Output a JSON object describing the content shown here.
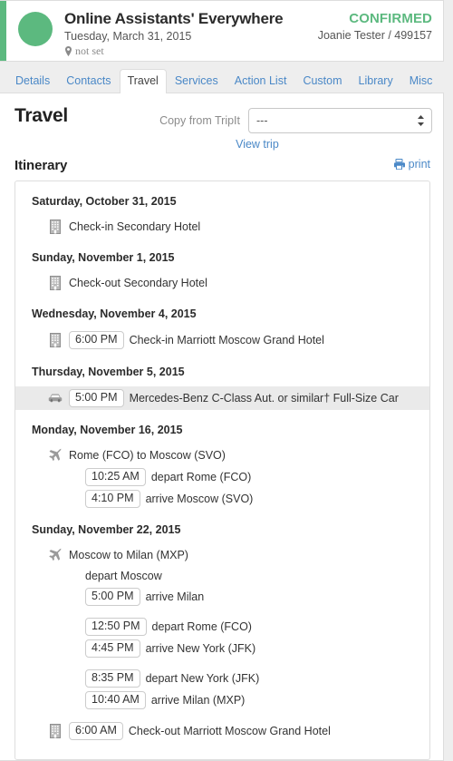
{
  "header": {
    "title": "Online Assistants' Everywhere",
    "date": "Tuesday, March 31, 2015",
    "location": "not set",
    "location_icon": "map-pin-icon",
    "status": "CONFIRMED",
    "owner": "Joanie Tester / 499157",
    "accent_color": "#5cb97f",
    "status_color": "#5cb97f"
  },
  "tabs": [
    {
      "label": "Details",
      "active": false
    },
    {
      "label": "Contacts",
      "active": false
    },
    {
      "label": "Travel",
      "active": true
    },
    {
      "label": "Services",
      "active": false
    },
    {
      "label": "Action List",
      "active": false
    },
    {
      "label": "Custom",
      "active": false
    },
    {
      "label": "Library",
      "active": false
    },
    {
      "label": "Misc",
      "active": false
    }
  ],
  "travel": {
    "title": "Travel",
    "copy_label": "Copy from TripIt",
    "select_value": "---",
    "view_trip_label": "View trip",
    "itinerary_label": "Itinerary",
    "print_label": "print",
    "print_icon": "printer-icon",
    "link_color": "#4a88c7"
  },
  "itinerary": [
    {
      "date": "Saturday, October 31, 2015",
      "rows": [
        {
          "icon": "hotel-icon",
          "time": "",
          "text": "Check-in Secondary Hotel",
          "highlight": false,
          "indent": false
        }
      ]
    },
    {
      "date": "Sunday, November 1, 2015",
      "rows": [
        {
          "icon": "hotel-icon",
          "time": "",
          "text": "Check-out Secondary Hotel",
          "highlight": false,
          "indent": false
        }
      ]
    },
    {
      "date": "Wednesday, November 4, 2015",
      "rows": [
        {
          "icon": "hotel-icon",
          "time": "6:00 PM",
          "text": "Check-in Marriott Moscow Grand Hotel",
          "highlight": false,
          "indent": false
        }
      ]
    },
    {
      "date": "Thursday, November 5, 2015",
      "rows": [
        {
          "icon": "car-icon",
          "time": "5:00 PM",
          "text": "Mercedes-Benz C-Class Aut. or similar† Full-Size Car",
          "highlight": true,
          "indent": false
        }
      ]
    },
    {
      "date": "Monday, November 16, 2015",
      "rows": [
        {
          "icon": "plane-icon",
          "time": "",
          "text": "Rome (FCO) to Moscow (SVO)",
          "highlight": false,
          "indent": false
        },
        {
          "icon": "",
          "time": "10:25 AM",
          "text": "depart Rome (FCO)",
          "highlight": false,
          "indent": true
        },
        {
          "icon": "",
          "time": "4:10 PM",
          "text": "arrive Moscow (SVO)",
          "highlight": false,
          "indent": true
        }
      ]
    },
    {
      "date": "Sunday, November 22, 2015",
      "rows": [
        {
          "icon": "plane-icon",
          "time": "",
          "text": "Moscow to Milan (MXP)",
          "highlight": false,
          "indent": false
        },
        {
          "icon": "",
          "time": "",
          "text": "depart Moscow",
          "highlight": false,
          "indent": true
        },
        {
          "icon": "",
          "time": "5:00 PM",
          "text": "arrive Milan",
          "highlight": false,
          "indent": true
        },
        {
          "icon": "",
          "time": "",
          "text": "",
          "highlight": false,
          "indent": true,
          "spacer": true
        },
        {
          "icon": "",
          "time": "12:50 PM",
          "text": "depart Rome (FCO)",
          "highlight": false,
          "indent": true
        },
        {
          "icon": "",
          "time": "4:45 PM",
          "text": "arrive New York (JFK)",
          "highlight": false,
          "indent": true
        },
        {
          "icon": "",
          "time": "",
          "text": "",
          "highlight": false,
          "indent": true,
          "spacer": true
        },
        {
          "icon": "",
          "time": "8:35 PM",
          "text": "depart New York (JFK)",
          "highlight": false,
          "indent": true
        },
        {
          "icon": "",
          "time": "10:40 AM",
          "text": "arrive Milan (MXP)",
          "highlight": false,
          "indent": true
        },
        {
          "icon": "",
          "time": "",
          "text": "",
          "highlight": false,
          "indent": true,
          "spacer": true
        },
        {
          "icon": "hotel-icon",
          "time": "6:00 AM",
          "text": "Check-out Marriott Moscow Grand Hotel",
          "highlight": false,
          "indent": false
        }
      ]
    }
  ]
}
